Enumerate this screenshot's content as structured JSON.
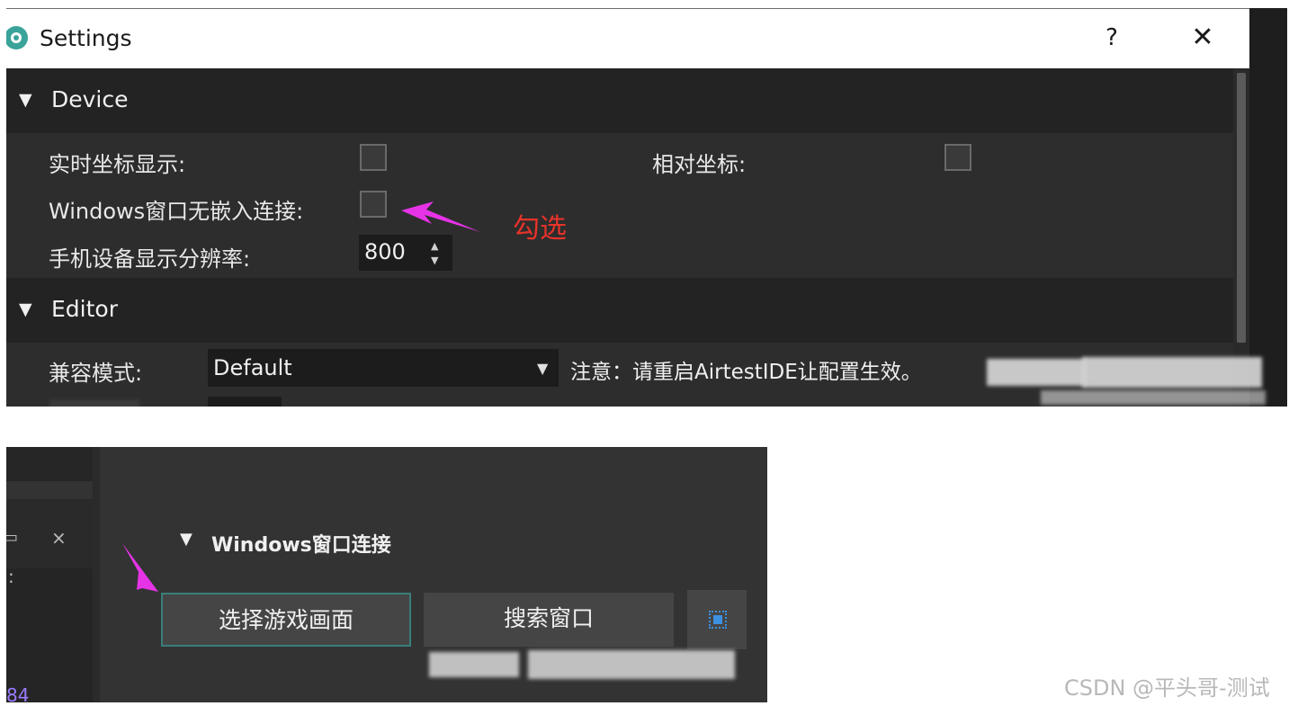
{
  "settings": {
    "title": "Settings",
    "help_label": "?",
    "close_label": "✕",
    "sections": {
      "device": {
        "title": "Device",
        "realtime_coords_label": "实时坐标显示:",
        "relative_coords_label": "相对坐标:",
        "windows_embed_label": "Windows窗口无嵌入连接:",
        "resolution_label": "手机设备显示分辨率:",
        "resolution_value": "800",
        "realtime_coords_checked": false,
        "relative_coords_checked": false,
        "windows_embed_checked": false
      },
      "editor": {
        "title": "Editor",
        "compat_mode_label": "兼容模式:",
        "compat_mode_value": "Default",
        "notice": "注意：请重启AirtestIDE让配置生效。"
      }
    }
  },
  "annotation": {
    "text": "勾选",
    "color": "#e8332a",
    "arrow_color": "#e633e6"
  },
  "windows_panel": {
    "section_title": "Windows窗口连接",
    "select_game_button": "选择游戏画面",
    "search_window_button": "搜索窗口",
    "close_glyph": "×",
    "colon_glyph": ":",
    "line_number": "84"
  },
  "watermark": "CSDN @平头哥-测试"
}
